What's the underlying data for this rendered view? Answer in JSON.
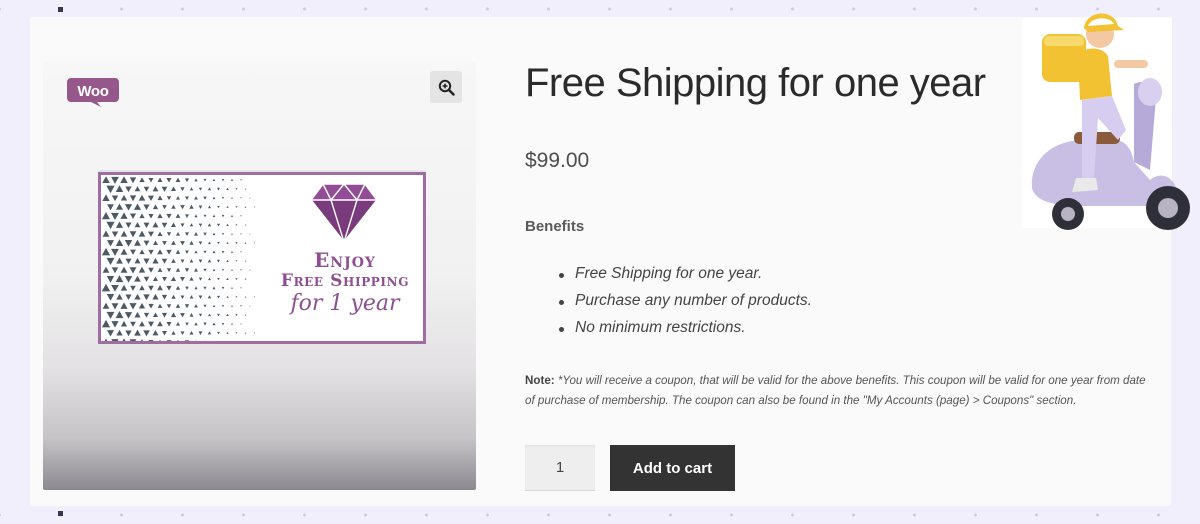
{
  "product": {
    "title": "Free Shipping for one year",
    "price": "$99.00",
    "benefits_heading": "Benefits",
    "benefits": [
      "Free Shipping for one year.",
      "Purchase any number of products.",
      "No minimum restrictions."
    ],
    "note_label": "Note:",
    "note_text": "*You will receive a coupon, that will be valid for the above benefits. This coupon will be valid for one year from date of purchase of membership. The coupon can also be found in the \"My Accounts (page) > Coupons\" section.",
    "quantity": "1",
    "add_to_cart_label": "Add to cart"
  },
  "gallery": {
    "logo_text": "Woo",
    "zoom_icon": "magnifier-zoom-icon",
    "banner": {
      "line1": "Enjoy",
      "line2": "Free Shipping",
      "line3": "for 1 year",
      "icon": "diamond-icon"
    }
  },
  "colors": {
    "accent_purple": "#96588a",
    "banner_border": "#a06ca4",
    "button_dark": "#333333",
    "frame_bg": "#f1effb"
  }
}
